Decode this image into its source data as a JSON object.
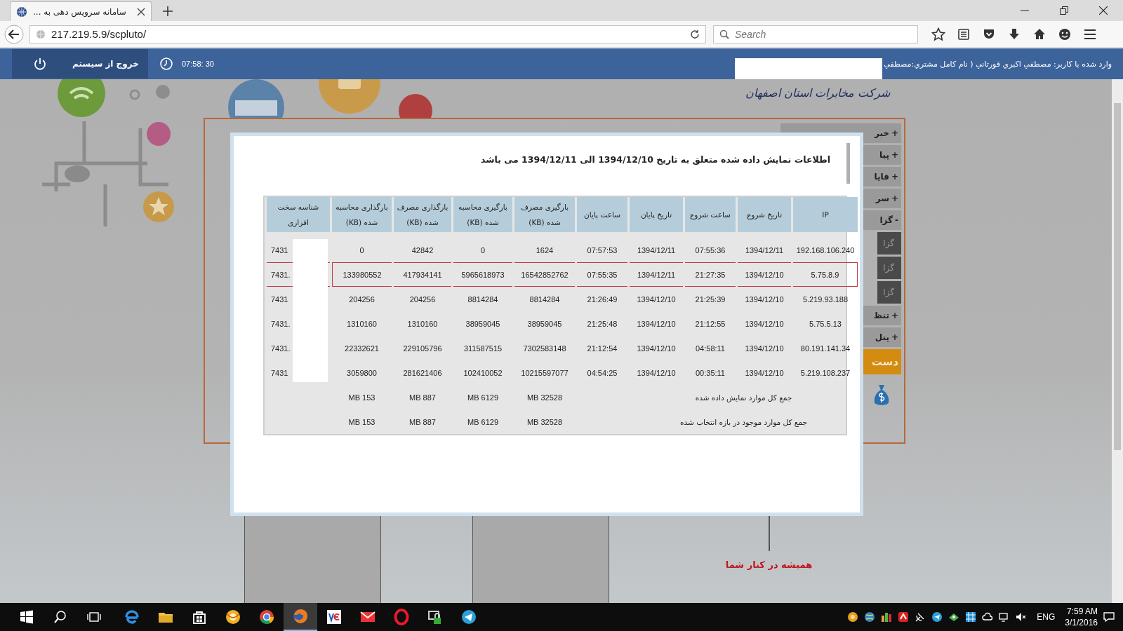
{
  "browser": {
    "tab_title": "سامانه سرویس دهی به ...",
    "url": "217.219.5.9/scpluto/",
    "search_placeholder": "Search"
  },
  "site_header": {
    "logout_label": "خروج از سیستم",
    "clock": "07:58: 30",
    "user_info": "وارد شده با کاربر: مصطفي اکبري قورتاني ( نام کامل مشتري:مصطفي"
  },
  "logo_text": "شرکت مخابرات استان اصفهان",
  "sidebar": {
    "items": [
      {
        "kind": "group",
        "sign": "+",
        "label": "خبر"
      },
      {
        "kind": "group",
        "sign": "+",
        "label": "پیا"
      },
      {
        "kind": "group",
        "sign": "+",
        "label": "فایا"
      },
      {
        "kind": "group",
        "sign": "+",
        "label": "سر"
      },
      {
        "kind": "group",
        "sign": "-",
        "label": "گزا"
      },
      {
        "kind": "sub",
        "label": "گزا"
      },
      {
        "kind": "sub",
        "label": "گزا"
      },
      {
        "kind": "sub",
        "label": "گزا"
      },
      {
        "kind": "group",
        "sign": "+",
        "label": "تنظ"
      },
      {
        "kind": "group",
        "sign": "+",
        "label": "پنل"
      },
      {
        "kind": "banner",
        "label": "دست"
      }
    ]
  },
  "modal": {
    "title": "اطلاعات نمایش داده شده متعلق به تاریخ 1394/12/10 الی 1394/12/11 می باشد",
    "table": {
      "columns": [
        "IP",
        "تاریخ شروع",
        "ساعت شروع",
        "تاریخ پایان",
        "ساعت پایان",
        "بارگیری مصرف\nشده (KB)",
        "بارگیری محاسبه\nشده (KB)",
        "بارگذاری مصرف\nشده (KB)",
        "بارگذاری محاسبه\nشده (KB)",
        "شناسه سخت\nافزاری"
      ],
      "rows": [
        {
          "selected": false,
          "cells": [
            "192.168.106.240",
            "1394/12/11",
            "07:55:36",
            "1394/12/11",
            "07:57:53",
            "1624",
            "0",
            "42842",
            "0",
            "7431"
          ]
        },
        {
          "selected": true,
          "cells": [
            "5.75.8.9",
            "1394/12/10",
            "21:27:35",
            "1394/12/11",
            "07:55:35",
            "16542852762",
            "5965618973",
            "417934141",
            "133980552",
            "7431."
          ]
        },
        {
          "selected": false,
          "cells": [
            "5.219.93.188",
            "1394/12/10",
            "21:25:39",
            "1394/12/10",
            "21:26:49",
            "8814284",
            "8814284",
            "204256",
            "204256",
            "7431"
          ]
        },
        {
          "selected": false,
          "cells": [
            "5.75.5.13",
            "1394/12/10",
            "21:12:55",
            "1394/12/10",
            "21:25:48",
            "38959045",
            "38959045",
            "1310160",
            "1310160",
            "7431."
          ]
        },
        {
          "selected": false,
          "cells": [
            "80.191.141.34",
            "1394/12/10",
            "04:58:11",
            "1394/12/10",
            "21:12:54",
            "7302583148",
            "311587515",
            "229105796",
            "22332621",
            "7431."
          ]
        },
        {
          "selected": false,
          "cells": [
            "5.219.108.237",
            "1394/12/10",
            "00:35:11",
            "1394/12/10",
            "04:54:25",
            "10215597077",
            "102410052",
            "281621406",
            "3059800",
            "7431"
          ]
        }
      ],
      "totals": [
        {
          "label": "جمع کل موارد نمایش داده شده",
          "values": [
            "MB 32528",
            "MB 6129",
            "MB 887",
            "MB 153"
          ]
        },
        {
          "label": "جمع کل موارد موجود در بازه انتخاب شده",
          "values": [
            "MB 32528",
            "MB 6129",
            "MB 887",
            "MB 153"
          ]
        }
      ]
    }
  },
  "footer_slogan": "همیشه در کنار شما",
  "taskbar": {
    "apps": [
      {
        "kind": "swirl",
        "selected": false
      },
      {
        "kind": "folder",
        "selected": false
      },
      {
        "kind": "bag",
        "selected": false
      },
      {
        "kind": "orb",
        "selected": false
      },
      {
        "kind": "wheel",
        "selected": false
      },
      {
        "kind": "globe",
        "selected": true
      },
      {
        "kind": "tile",
        "selected": false
      },
      {
        "kind": "envelope",
        "selected": false
      },
      {
        "kind": "ring",
        "selected": false
      },
      {
        "kind": "lock",
        "selected": false
      },
      {
        "kind": "plane",
        "selected": false
      }
    ],
    "language": "ENG",
    "time": "7:59 AM",
    "date": "3/1/2016"
  }
}
